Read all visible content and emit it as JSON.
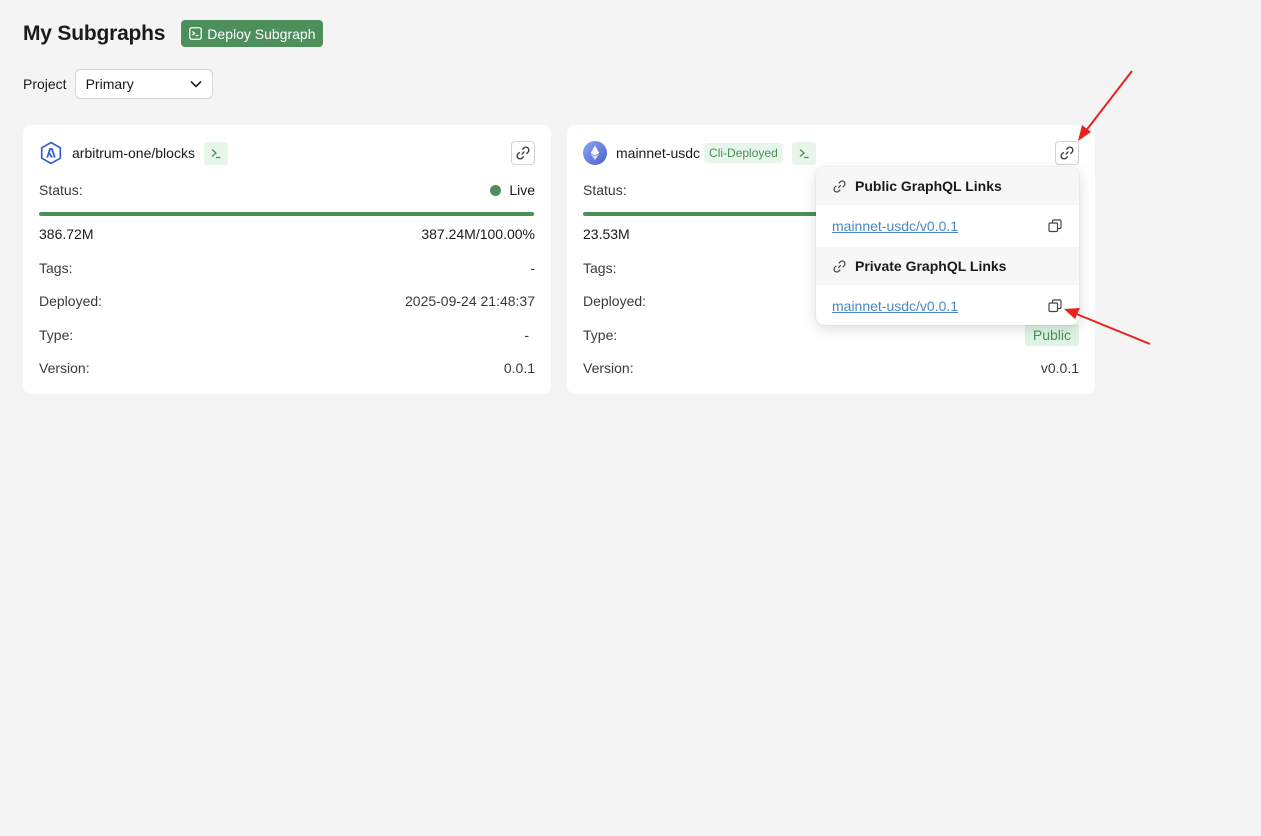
{
  "header": {
    "title": "My Subgraphs",
    "deploy_label": "Deploy Subgraph"
  },
  "project": {
    "label": "Project",
    "selected": "Primary"
  },
  "cards": [
    {
      "name": "arbitrum-one/blocks",
      "status_label": "Status:",
      "status_value": "Live",
      "progress_fraction": 0.9987,
      "progress_left": "386.72M",
      "progress_right": "387.24M/100.00%",
      "tags_label": "Tags:",
      "tags_value": "-",
      "deployed_label": "Deployed:",
      "deployed_value": "2025-09-24 21:48:37",
      "type_label": "Type:",
      "type_value": "-",
      "version_label": "Version:",
      "version_value": "0.0.1"
    },
    {
      "name": "mainnet-usdc",
      "badge": "Cli-Deployed",
      "status_label": "Status:",
      "progress_left": "23.53M",
      "tags_label": "Tags:",
      "deployed_label": "Deployed:",
      "type_label": "Type:",
      "type_value": "Public",
      "version_label": "Version:",
      "version_value": "v0.0.1"
    }
  ],
  "popover": {
    "public_heading": "Public GraphQL Links",
    "public_link": "mainnet-usdc/v0.0.1",
    "private_heading": "Private GraphQL Links",
    "private_link": "mainnet-usdc/v0.0.1"
  },
  "colors": {
    "accent_green": "#4c8f5b",
    "link_blue": "#4a86c8",
    "annotation_red": "#e8231c"
  }
}
